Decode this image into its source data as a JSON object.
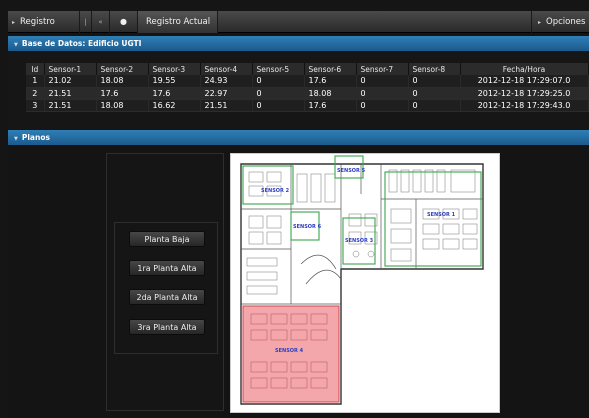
{
  "toolbar": {
    "registro_label": "Registro",
    "registro_actual_label": "Registro Actual",
    "opciones_label": "Opciones"
  },
  "database_section": {
    "title": "Base de Datos: Edificio UGTI"
  },
  "table": {
    "columns": [
      "Id",
      "Sensor-1",
      "Sensor-2",
      "Sensor-3",
      "Sensor-4",
      "Sensor-5",
      "Sensor-6",
      "Sensor-7",
      "Sensor-8",
      "Fecha/Hora"
    ],
    "rows": [
      [
        "1",
        "21.02",
        "18.08",
        "19.55",
        "24.93",
        "0",
        "17.6",
        "0",
        "0",
        "2012-12-18 17:29:07.0"
      ],
      [
        "2",
        "21.51",
        "17.6",
        "17.6",
        "22.97",
        "0",
        "18.08",
        "0",
        "0",
        "2012-12-18 17:29:25.0"
      ],
      [
        "3",
        "21.51",
        "18.08",
        "16.62",
        "21.51",
        "0",
        "17.6",
        "0",
        "0",
        "2012-12-18 17:29:43.0"
      ]
    ],
    "selected_row": 1,
    "highlight_color": "#e0232b"
  },
  "planos_section": {
    "title": "Planos",
    "buttons": {
      "planta_baja": "Planta Baja",
      "planta_1": "1ra Planta Alta",
      "planta_2": "2da Planta Alta",
      "planta_3": "3ra Planta Alta"
    }
  },
  "floor_plan": {
    "sensor_zone_color": "#3aa64a",
    "active_zone_color": "#f08a8f",
    "sensors": {
      "s1": "SENSOR 1",
      "s2": "SENSOR 2",
      "s3": "SENSOR 3",
      "s4": "SENSOR 4",
      "s5": "SENSOR 5",
      "s6": "SENSOR 6"
    }
  }
}
